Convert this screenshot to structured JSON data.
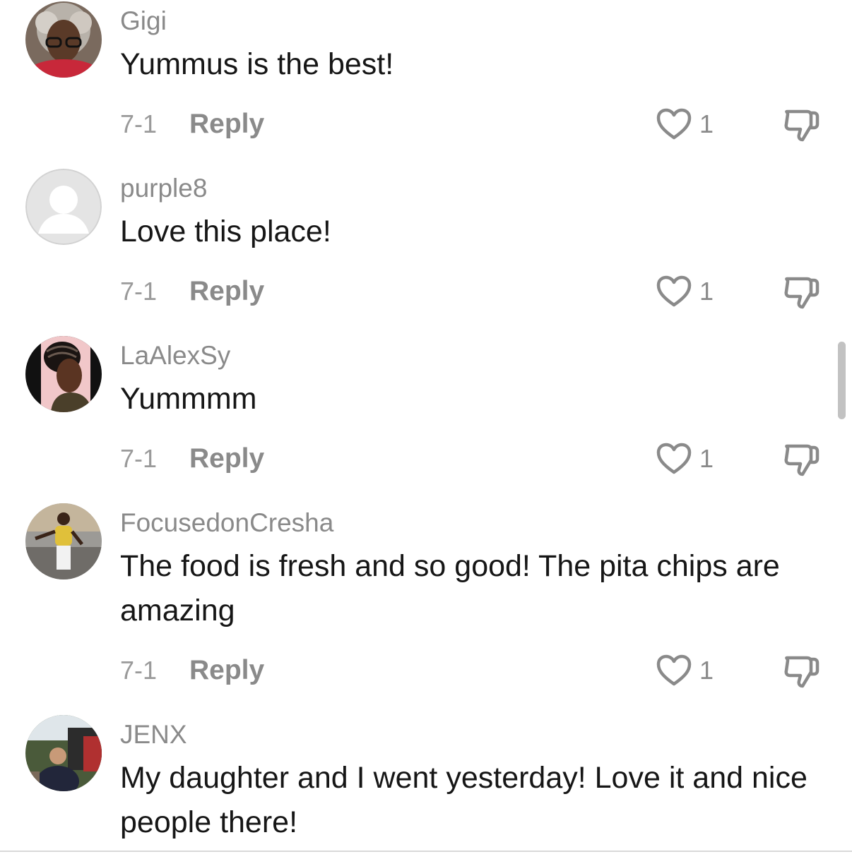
{
  "comments": [
    {
      "username": "Gigi",
      "text": "Yummus is the best!",
      "date": "7-1",
      "reply_label": "Reply",
      "likes": "1"
    },
    {
      "username": "purple8",
      "text": "Love this place!",
      "date": "7-1",
      "reply_label": "Reply",
      "likes": "1"
    },
    {
      "username": "LaAlexSy",
      "text": "Yummmm",
      "date": "7-1",
      "reply_label": "Reply",
      "likes": "1"
    },
    {
      "username": "FocusedonCresha",
      "text": "The food is fresh and so good! The pita chips are amazing",
      "date": "7-1",
      "reply_label": "Reply",
      "likes": "1"
    },
    {
      "username": "JENX",
      "text": "My daughter and I went yesterday! Love it and nice people there!"
    }
  ],
  "icons": {
    "like": "heart-outline-icon",
    "dislike": "thumbs-down-outline-icon"
  },
  "colors": {
    "username": "#8a8a8a",
    "text": "#161616",
    "meta": "#9a9a9a",
    "icon": "#8a8a8a"
  }
}
